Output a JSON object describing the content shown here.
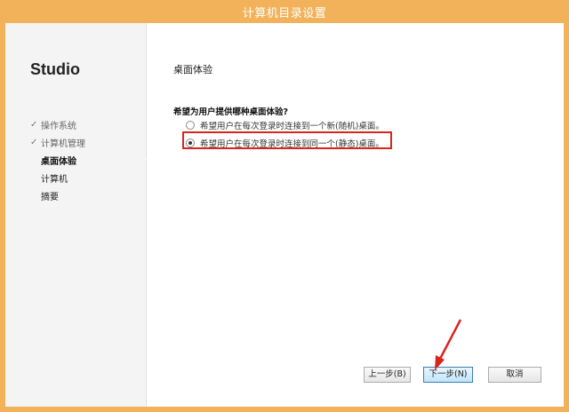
{
  "window": {
    "title": "计算机目录设置"
  },
  "sidebar": {
    "brand": "Studio",
    "steps": [
      {
        "label": "操作系统",
        "state": "done"
      },
      {
        "label": "计算机管理",
        "state": "done"
      },
      {
        "label": "桌面体验",
        "state": "current"
      },
      {
        "label": "计算机",
        "state": "todo"
      },
      {
        "label": "摘要",
        "state": "todo"
      }
    ],
    "check_glyph": "✓"
  },
  "main": {
    "page_title": "桌面体验",
    "question": "希望为用户提供哪种桌面体验?",
    "options": [
      {
        "label": "希望用户在每次登录时连接到一个新(随机)桌面。",
        "selected": false
      },
      {
        "label": "希望用户在每次登录时连接到同一个(静态)桌面。",
        "selected": true
      }
    ]
  },
  "buttons": {
    "prev": "上一步(B)",
    "next": "下一步(N)",
    "cancel": "取消"
  },
  "colors": {
    "titlebar": "#f2b25a",
    "highlight": "#d9251d",
    "annotation_arrow": "#d9251d"
  }
}
